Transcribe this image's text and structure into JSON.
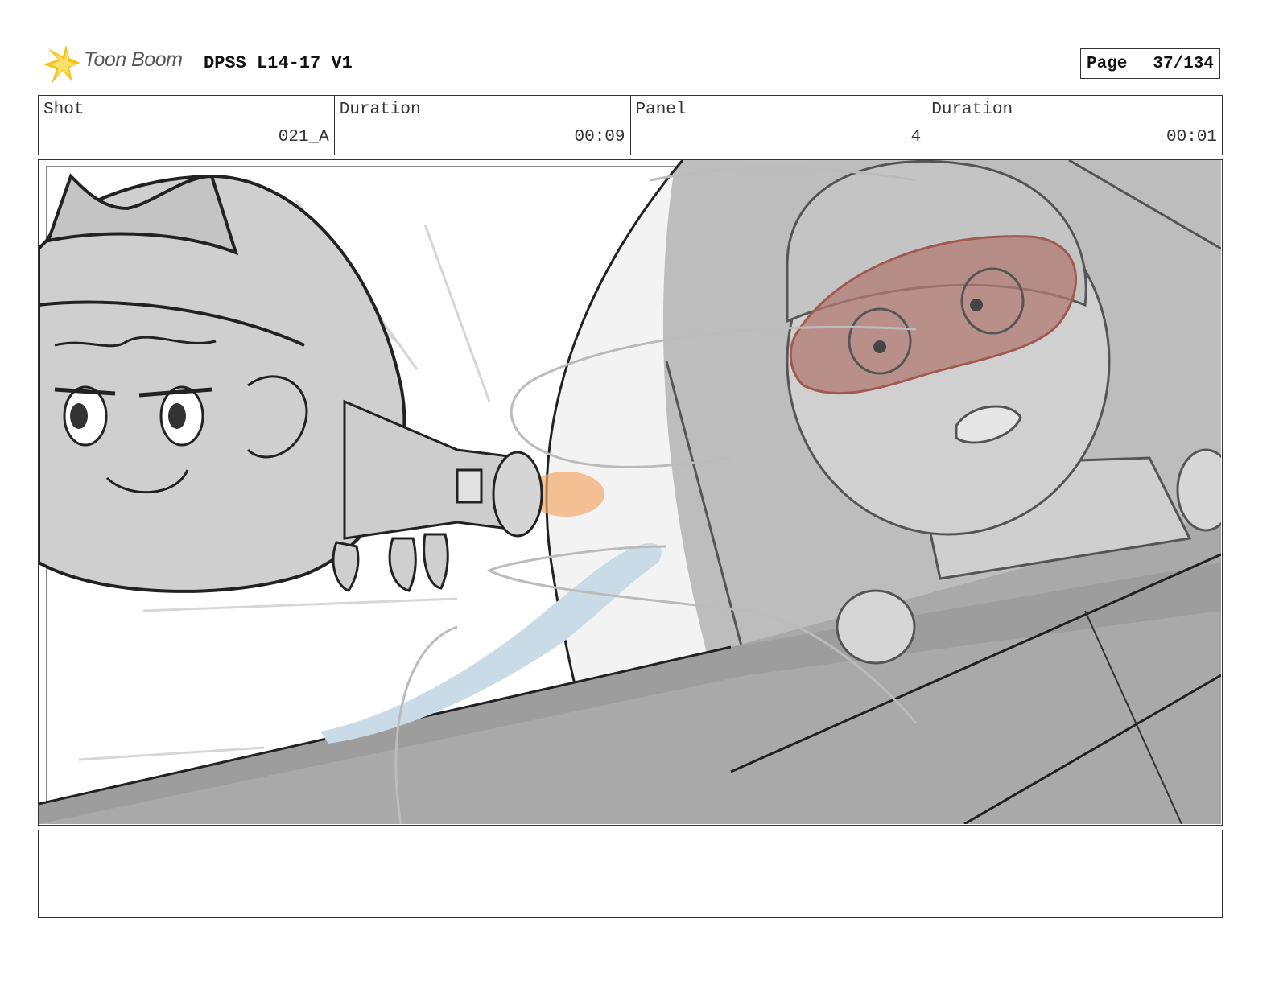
{
  "header": {
    "logo_text": "Toon Boom",
    "project_title": "DPSS L14-17 V1",
    "page_label": "Page",
    "page_number": "37/134"
  },
  "info_row": {
    "shot": {
      "label": "Shot",
      "value": "021_A"
    },
    "shot_duration": {
      "label": "Duration",
      "value": "00:09"
    },
    "panel": {
      "label": "Panel",
      "value": "4"
    },
    "panel_duration": {
      "label": "Duration",
      "value": "00:01"
    }
  },
  "panel_image": {
    "icons": [
      "hero-character-sketch",
      "jetpack-thruster",
      "pilot-character-sketch",
      "cockpit-canopy"
    ],
    "colors": {
      "goggles": "#b07b72",
      "thruster_flame": "#f4a96a",
      "water_trail": "#c9dbe6",
      "background_gray": "#c8c8c8"
    }
  },
  "notes": {
    "text": ""
  }
}
